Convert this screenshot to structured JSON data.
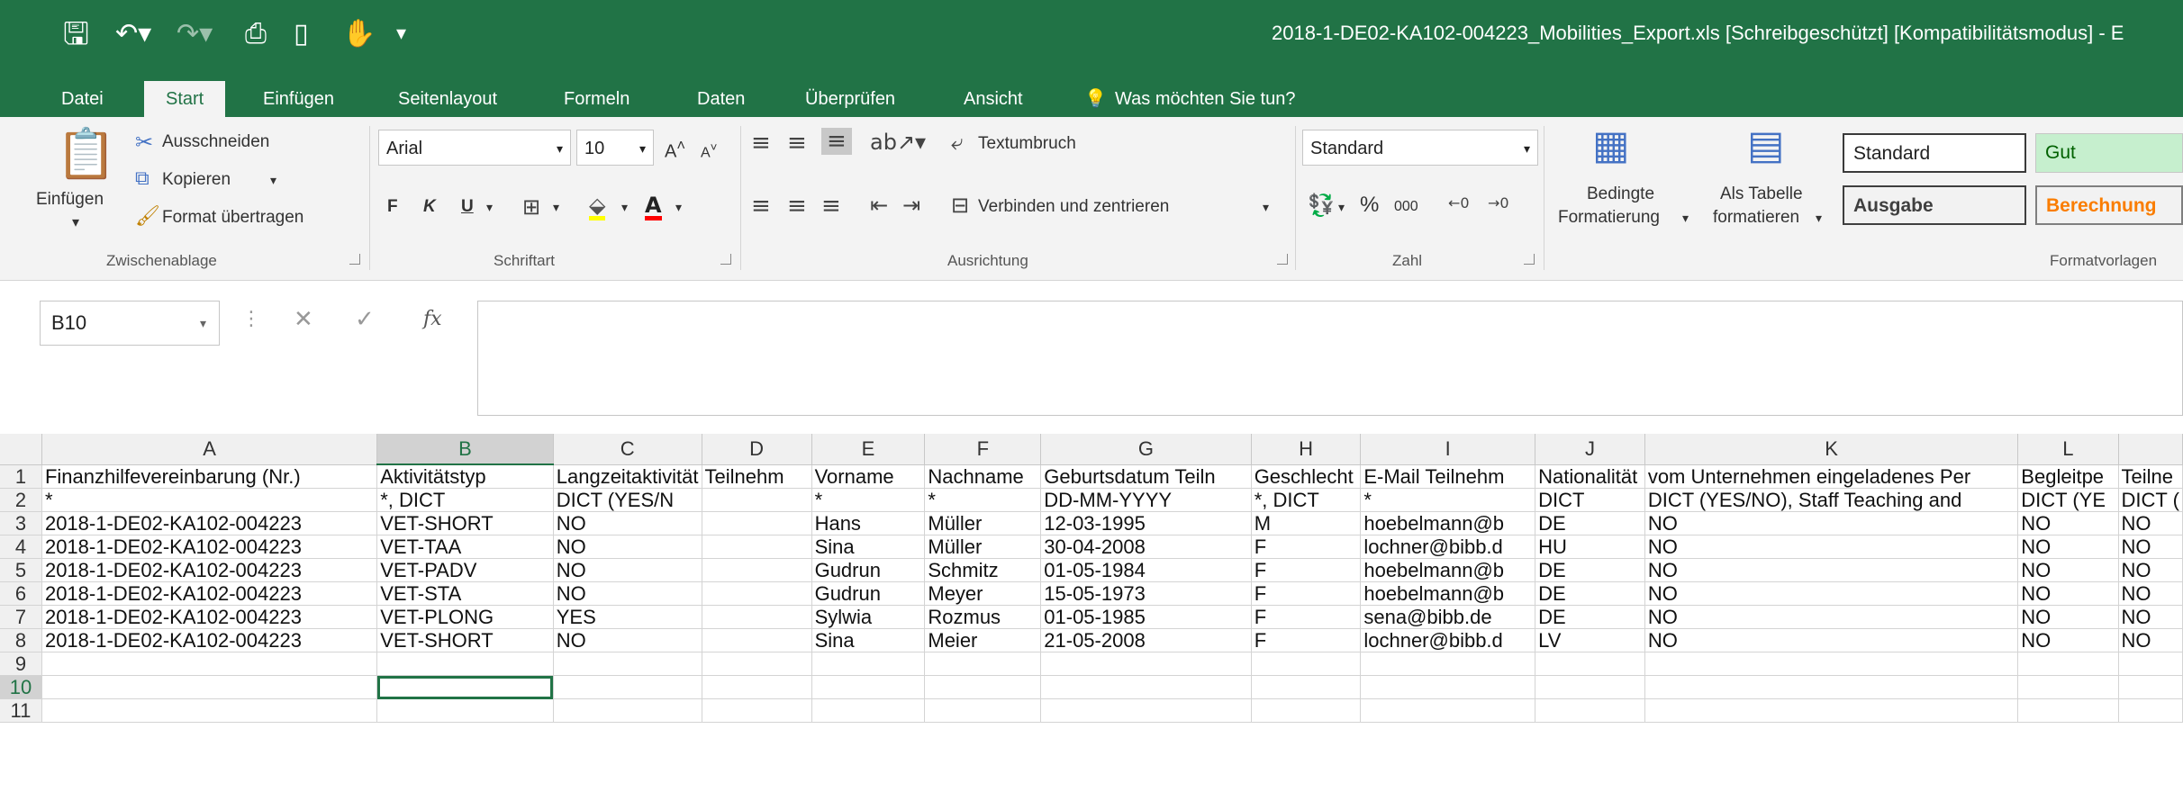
{
  "app": {
    "title": "2018-1-DE02-KA102-004223_Mobilities_Export.xls  [Schreibgeschützt]  [Kompatibilitätsmodus] - E"
  },
  "quick_access": [
    "save-icon",
    "undo-icon",
    "redo-icon",
    "print-preview-icon",
    "new-icon",
    "touch-mode-icon",
    "customize-icon"
  ],
  "tabs": [
    "Datei",
    "Start",
    "Einfügen",
    "Seitenlayout",
    "Formeln",
    "Daten",
    "Überprüfen",
    "Ansicht"
  ],
  "tell_me": "Was möchten Sie tun?",
  "ribbon": {
    "clipboard": {
      "paste": "Einfügen",
      "cut": "Ausschneiden",
      "copy": "Kopieren",
      "format_painter": "Format übertragen",
      "group": "Zwischenablage"
    },
    "font": {
      "name": "Arial",
      "size": "10",
      "bold": "F",
      "italic": "K",
      "underline": "U",
      "group": "Schriftart"
    },
    "alignment": {
      "wrap": "Textumbruch",
      "merge": "Verbinden und zentrieren",
      "group": "Ausrichtung"
    },
    "number": {
      "format": "Standard",
      "percent": "%",
      "thousands": "000",
      "group": "Zahl"
    },
    "styles": {
      "conditional_1": "Bedingte",
      "conditional_2": "Formatierung",
      "as_table_1": "Als Tabelle",
      "as_table_2": "formatieren",
      "standard": "Standard",
      "gut": "Gut",
      "ausgabe": "Ausgabe",
      "berechnung": "Berechnung",
      "group": "Formatvorlagen"
    }
  },
  "formula_bar": {
    "name_box": "B10",
    "fx": "fx",
    "content": ""
  },
  "colors": {
    "accent": "#217346",
    "gut_bg": "#c6efce",
    "gut_fg": "#006100",
    "berechnung_fg": "#fa7d00",
    "ausgabe_bg": "#f2f2f2"
  },
  "sheet": {
    "columns": [
      "A",
      "B",
      "C",
      "D",
      "E",
      "F",
      "G",
      "H",
      "I",
      "J",
      "K",
      "L",
      ""
    ],
    "rows": [
      {
        "n": "1",
        "cells": [
          "Finanzhilfevereinbarung (Nr.)",
          "Aktivitätstyp",
          "Langzeitaktivität",
          "Teilnehm",
          "Vorname",
          "Nachname",
          "Geburtsdatum Teiln",
          "Geschlecht",
          "E-Mail Teilnehm",
          "Nationalität",
          "vom Unternehmen eingeladenes Per",
          "Begleitpe",
          "Teilne"
        ]
      },
      {
        "n": "2",
        "cells": [
          "*",
          "*, DICT",
          "DICT (YES/N",
          "",
          "*",
          "*",
          "DD-MM-YYYY",
          "*, DICT",
          "*",
          "DICT",
          "DICT (YES/NO), Staff Teaching and",
          "DICT (YE",
          "DICT ("
        ]
      },
      {
        "n": "3",
        "cells": [
          "2018-1-DE02-KA102-004223",
          "VET-SHORT",
          "NO",
          "",
          "Hans",
          "Müller",
          "12-03-1995",
          "M",
          "hoebelmann@b",
          "DE",
          "NO",
          "NO",
          "NO"
        ]
      },
      {
        "n": "4",
        "cells": [
          "2018-1-DE02-KA102-004223",
          "VET-TAA",
          "NO",
          "",
          "Sina",
          "Müller",
          "30-04-2008",
          "F",
          "lochner@bibb.d",
          "HU",
          "NO",
          "NO",
          "NO"
        ]
      },
      {
        "n": "5",
        "cells": [
          "2018-1-DE02-KA102-004223",
          "VET-PADV",
          "NO",
          "",
          "Gudrun",
          "Schmitz",
          "01-05-1984",
          "F",
          "hoebelmann@b",
          "DE",
          "NO",
          "NO",
          "NO"
        ]
      },
      {
        "n": "6",
        "cells": [
          "2018-1-DE02-KA102-004223",
          "VET-STA",
          "NO",
          "",
          "Gudrun",
          "Meyer",
          "15-05-1973",
          "F",
          "hoebelmann@b",
          "DE",
          "NO",
          "NO",
          "NO"
        ]
      },
      {
        "n": "7",
        "cells": [
          "2018-1-DE02-KA102-004223",
          "VET-PLONG",
          "YES",
          "",
          "Sylwia",
          "Rozmus",
          "01-05-1985",
          "F",
          "sena@bibb.de",
          "DE",
          "NO",
          "NO",
          "NO"
        ]
      },
      {
        "n": "8",
        "cells": [
          "2018-1-DE02-KA102-004223",
          "VET-SHORT",
          "NO",
          "",
          "Sina",
          "Meier",
          "21-05-2008",
          "F",
          "lochner@bibb.d",
          "LV",
          "NO",
          "NO",
          "NO"
        ]
      },
      {
        "n": "9",
        "cells": [
          "",
          "",
          "",
          "",
          "",
          "",
          "",
          "",
          "",
          "",
          "",
          "",
          ""
        ]
      },
      {
        "n": "10",
        "cells": [
          "",
          "",
          "",
          "",
          "",
          "",
          "",
          "",
          "",
          "",
          "",
          "",
          ""
        ]
      },
      {
        "n": "11",
        "cells": [
          "",
          "",
          "",
          "",
          "",
          "",
          "",
          "",
          "",
          "",
          "",
          "",
          ""
        ]
      }
    ]
  }
}
